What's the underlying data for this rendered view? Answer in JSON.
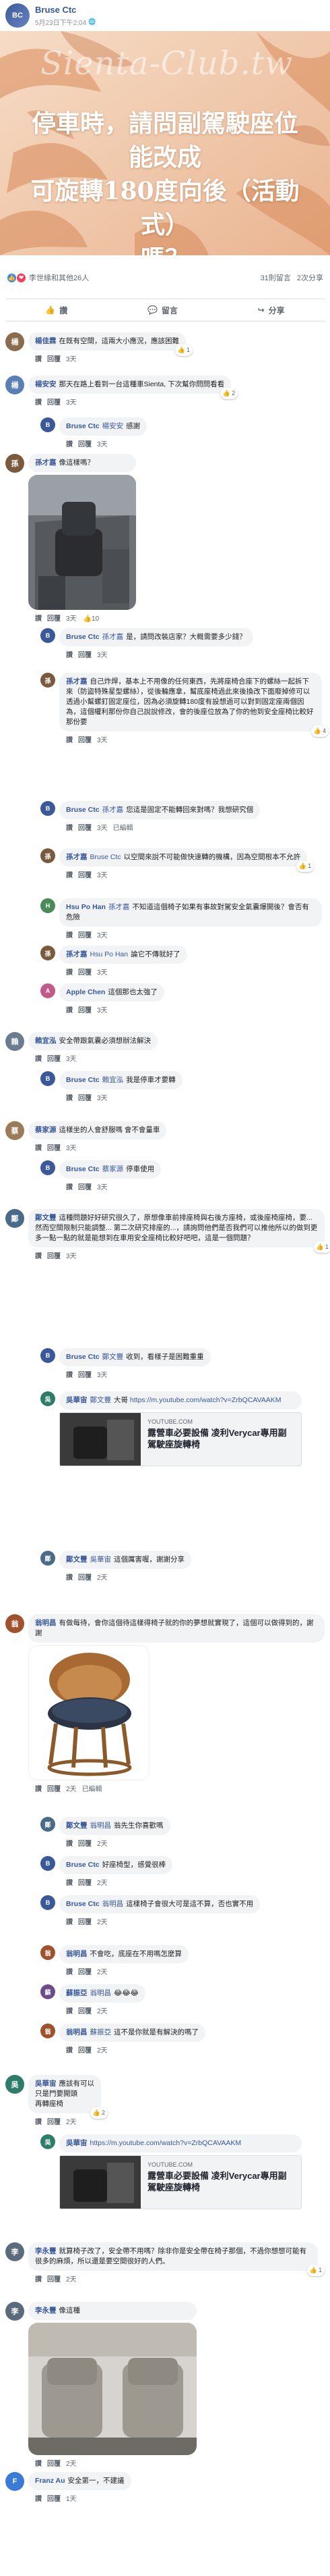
{
  "post": {
    "author": "Bruse Ctc",
    "author_initials": "BC",
    "timestamp": "5月23日下午2:04",
    "watermark": "Sienta-Club.tw",
    "image_title_line1": "停車時，請問副駕駛座位能改成",
    "image_title_line2": "可旋轉180度向後（活動式）",
    "image_title_line3": "嗎？",
    "reactions_text": "李世緣和其他26人",
    "comments_count": "31則留言",
    "shares_count": "2次分享",
    "like_label": "讚",
    "comment_label": "留言",
    "share_label": "分享"
  },
  "colors": {
    "accent": "#385898",
    "like": "#2d88ff",
    "love": "#f33e58",
    "bubble": "#f2f3f5"
  },
  "comments": [
    {
      "name": "楊佳霖",
      "text": "在既有空間，這兩大小應況，應該困難",
      "time": "3天",
      "likes": "1"
    },
    {
      "name": "楊安安",
      "text": "那天在路上看到一台這種車Sienta, 下次幫你問問看看",
      "time": "3天",
      "likes": "2"
    },
    {
      "name": "Bruse Ctc",
      "tag": "楊安安",
      "text": "感謝",
      "time": "3天"
    },
    {
      "name": "孫才嘉",
      "text": "像這樣嗎？",
      "time": "3天",
      "likes": "10"
    },
    {
      "name": "Bruse Ctc",
      "tag": "孫才嘉",
      "text": "是，請問改裝店家？大概需要多少錢？",
      "time": "3天"
    },
    {
      "name": "孫才嘉",
      "text": "自己炸焊，基本上不用像的任何東西，先將座椅合座下的螺絲一起拆下來（防盜特殊星型螺絲），從後輪應拿，幫底座椅過此來後換改下面廢掉修可以透過小幫螺釘固定座位，因為必須旋轉180度有設想過可以對到固定座兩個因為，這個權利那份你自己說說修改，會的後座位放為了你的他到安全座椅比較好那份要",
      "time": "3天",
      "likes": "4"
    },
    {
      "name": "Bruse Ctc",
      "tag": "孫才嘉",
      "text": "您這是固定不能轉回來對嗎？我想研究個",
      "time": "3天",
      "extra": "已編輯"
    },
    {
      "name": "孫才嘉",
      "tag": "Bruse Ctc",
      "text": "以空間來說不可能做快速轉的機構，因為空間根本不允許",
      "time": "3天",
      "likes": "1"
    },
    {
      "name": "Hsu Po Han",
      "tag": "孫才嘉",
      "text": "不知道這個椅子如果有事故對駕安全氣囊爆開後？會否有危險",
      "time": "3天"
    },
    {
      "name": "孫才嘉",
      "tag": "Hsu Po Han",
      "text": "論它不傳就好了",
      "time": "3天"
    },
    {
      "name": "Apple Chen",
      "text": "這個那也太強了",
      "time": "3天"
    },
    {
      "name": "賴宜泓",
      "text": "安全帶跟氣囊必須想辦法解決",
      "time": "3天"
    },
    {
      "name": "Bruse Ctc",
      "tag": "賴宜泓",
      "text": "我是停車才要轉",
      "time": "3天"
    },
    {
      "name": "蔡家源",
      "text": "這樣坐的人會舒服嗎 會不會量車",
      "time": "3天"
    },
    {
      "name": "Bruse Ctc",
      "tag": "蔡家源",
      "text": "停車使用",
      "time": "3天"
    },
    {
      "name": "鄭文豐",
      "text": "這種問題好好研究很久了，原想像車前排座椅與右後方座椅，或後座椅座椅，要... 然而空間限制只能調整... 第二次研究排座的...，請詢問他們是否我們可以推他所以的做到更多一點一點的就是能想到在車用安全座椅比較好吧吧，這是一個問題？",
      "time": "3天",
      "likes": "1"
    },
    {
      "name": "Bruse Ctc",
      "tag": "鄭文豐",
      "text": "收到，看樣子是困難重重",
      "time": "3天"
    },
    {
      "name": "吳華宙",
      "tag": "鄭文豐",
      "text": "大哥",
      "url": "https://m.youtube.com/watch?v=ZrbQCAVAAKM"
    },
    {
      "link_domain": "YOUTUBE.COM",
      "link_title": "露營車必要設備 凌利Verycar專用副駕駛座旋轉椅"
    },
    {
      "name": "鄭文豐",
      "tag": "吳華宙",
      "text": "這個厲害喔，謝謝分享",
      "time": "2天"
    },
    {
      "name": "翁明昌",
      "text": "有做每待，會你這個待這樣得椅子就的你的夢想就實現了，這個可以做得到的，謝謝",
      "time": "2天",
      "extra": "已編輯"
    },
    {
      "name": "鄭文豐",
      "tag": "翁明昌",
      "text": "翁先生你喜歡嗎",
      "time": "2天"
    },
    {
      "name": "Bruse Ctc",
      "text": "好座椅型，感覺很棒",
      "time": "2天"
    },
    {
      "name": "Bruse Ctc",
      "tag": "翁明昌",
      "text": "這樣椅子會很大可是這不算，否也實不用",
      "time": "2天"
    },
    {
      "name": "翁明昌",
      "text": "不會吃，底座在不用嗎怎麼算",
      "time": "2天"
    },
    {
      "name": "蘇振亞",
      "tag": "翁明昌",
      "text": "😂😂😂",
      "time": "2天"
    },
    {
      "name": "翁明昌",
      "tag": "蘇振亞",
      "text": "這不是你就是有解決的嗎了",
      "time": "2天"
    },
    {
      "name": "吳華宙",
      "text": "應該有可以\n只是門要開頭\n再轉座椅",
      "time": "2天",
      "likes": "2"
    },
    {
      "name": "吳華宙",
      "url": "https://m.youtube.com/watch?v=ZrbQCAVAAKM"
    },
    {
      "link_domain": "YOUTUBE.COM",
      "link_title": "露營車必要設備 凌利Verycar專用副駕駛座旋轉椅"
    },
    {
      "name": "李永豐",
      "text": "就算椅子改了，安全帶不用嗎？除非你是安全帶在椅子那個，不過你想想可能有很多的麻煩，所以還是要空間很好的人們。",
      "time": "2天",
      "likes": "1"
    },
    {
      "name": "李永豐",
      "text": "像這種",
      "time": "2天"
    },
    {
      "name": "Franz Au",
      "text": "安全第一，不建議",
      "time": "1天"
    }
  ],
  "thread_links": [
    {
      "text": ""
    },
    {
      "text": ""
    },
    {
      "text": ""
    }
  ]
}
